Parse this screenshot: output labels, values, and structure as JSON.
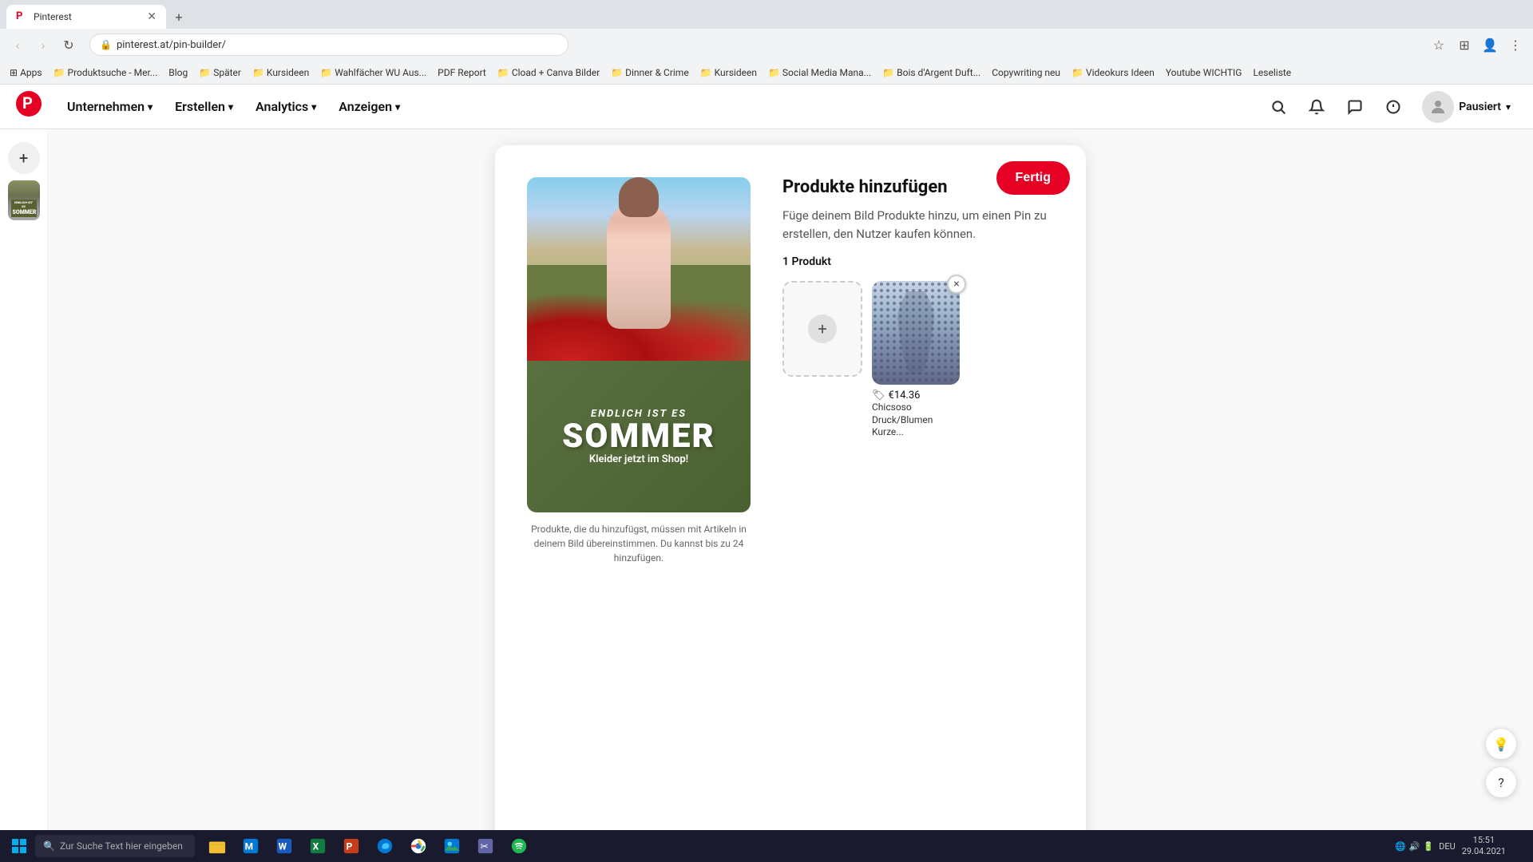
{
  "browser": {
    "tab_title": "Pinterest",
    "tab_favicon": "P",
    "address": "pinterest.at/pin-builder/",
    "new_tab_label": "+",
    "bookmarks": [
      {
        "label": "Apps"
      },
      {
        "label": "Produktsuche - Mer..."
      },
      {
        "label": "Blog"
      },
      {
        "label": "Später"
      },
      {
        "label": "Kursideen"
      },
      {
        "label": "Wahlfächer WU Aus..."
      },
      {
        "label": "PDF Report"
      },
      {
        "label": "Cload + Canva Bilder"
      },
      {
        "label": "Dinner & Crime"
      },
      {
        "label": "Kursideen"
      },
      {
        "label": "Social Media Mana..."
      },
      {
        "label": "Bois d'Argent Duft..."
      },
      {
        "label": "Copywriting neu"
      },
      {
        "label": "Videokurs Ideen"
      },
      {
        "label": "Youtube WICHTIG"
      },
      {
        "label": "Leseliste"
      }
    ]
  },
  "header": {
    "logo": "P",
    "nav": [
      {
        "label": "Unternehmen",
        "has_dropdown": true
      },
      {
        "label": "Erstellen",
        "has_dropdown": true
      },
      {
        "label": "Analytics",
        "has_dropdown": true
      },
      {
        "label": "Anzeigen",
        "has_dropdown": true
      }
    ],
    "search_icon": "🔍",
    "bell_icon": "🔔",
    "chat_icon": "💬",
    "notif_icon": "🔔",
    "avatar_label": "Pausiert"
  },
  "sidebar": {
    "add_icon": "+",
    "pin_thumb_alt": "Summer dress pin thumbnail"
  },
  "pin_card": {
    "fertig_label": "Fertig",
    "title": "Produkte hinzufügen",
    "description": "Füge deinem Bild Produkte hinzu, um einen Pin zu erstellen, den Nutzer kaufen können.",
    "product_count": "1 Produkt",
    "pin_image": {
      "top_text": "ENDLICH IST ES",
      "main_text": "SOMMER",
      "sub_text": "Kleider jetzt im Shop!"
    },
    "product": {
      "price": "€14.36",
      "name": "Chicsoso Druck/Blumen Kurze...",
      "remove_icon": "×"
    },
    "add_slot_icon": "+",
    "footer_text": "Produkte, die du hinzufügst, müssen mit Artikeln in deinem Bild übereinstimmen. Du kannst bis zu 24 hinzufügen."
  },
  "help": {
    "lightbulb_icon": "💡",
    "question_icon": "?"
  },
  "taskbar": {
    "start_icon": "⊞",
    "search_placeholder": "Zur Suche Text hier eingeben",
    "icons": [
      "🔍",
      "📁",
      "📁",
      "W",
      "X",
      "P",
      "🎵",
      "🌐",
      "🌐",
      "📋",
      "🎵"
    ],
    "time": "15:51",
    "date": "29.04.2021",
    "language": "DEU"
  }
}
